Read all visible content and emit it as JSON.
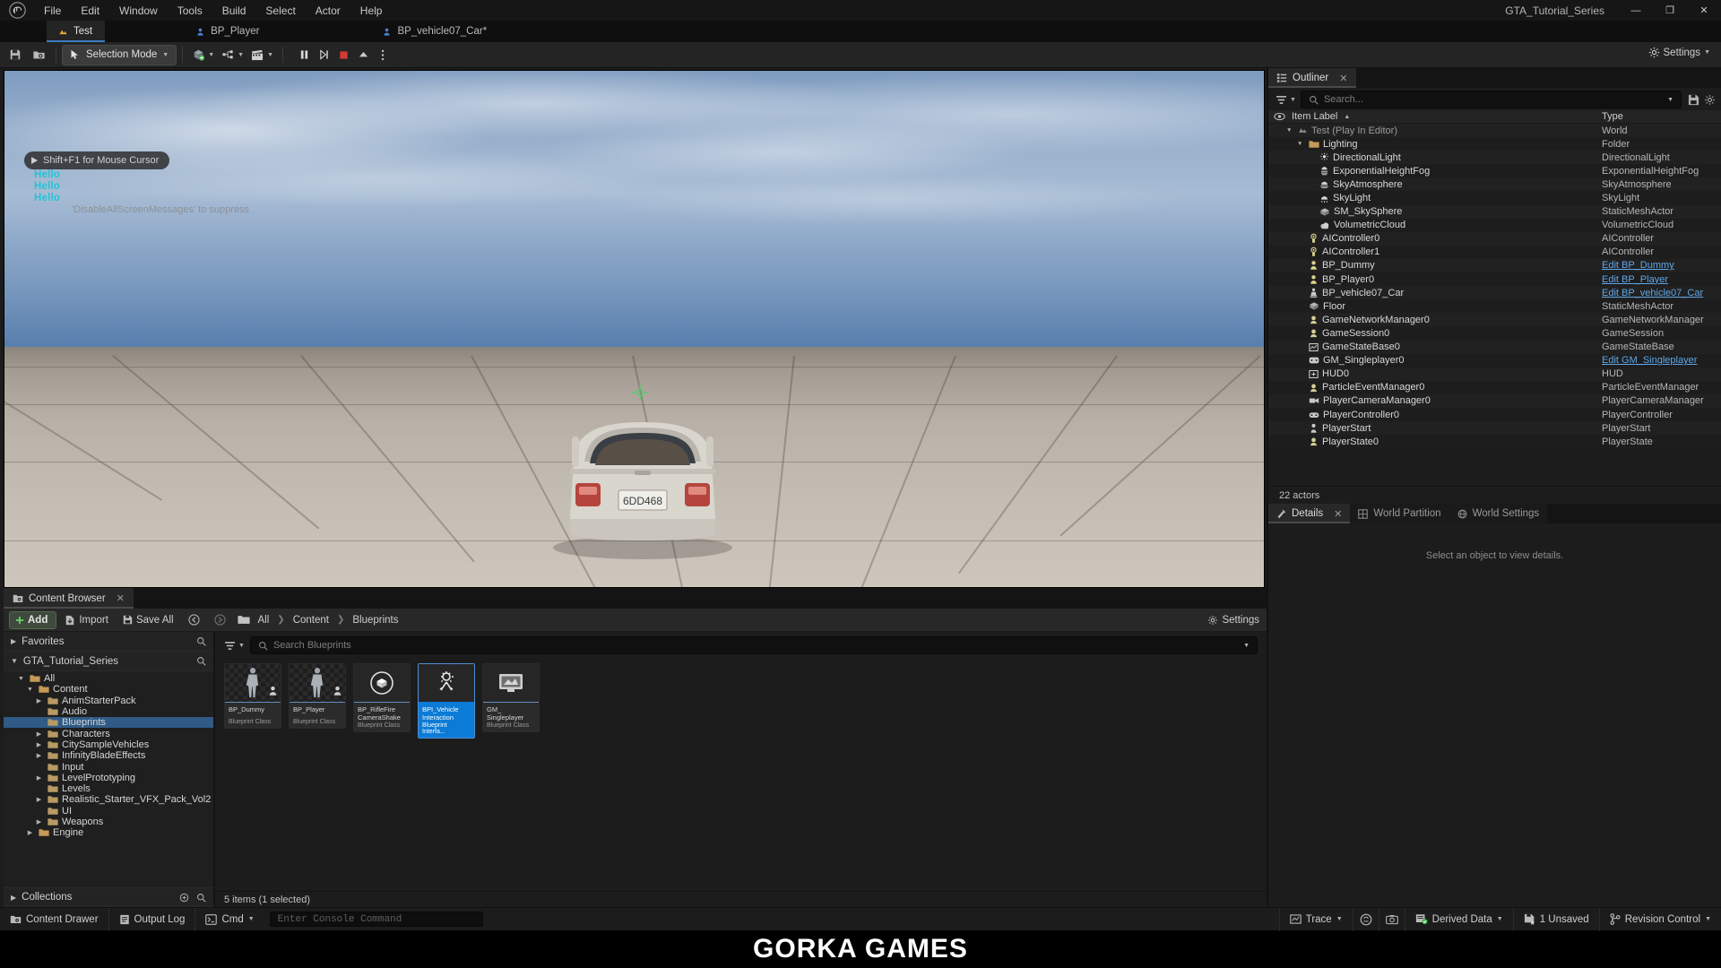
{
  "window": {
    "title": "GTA_Tutorial_Series",
    "minimize_label": "—",
    "maximize_label": "❐",
    "close_label": "✕"
  },
  "menubar": {
    "logo_name": "unreal-engine-logo",
    "items": [
      {
        "label": "File"
      },
      {
        "label": "Edit"
      },
      {
        "label": "Window"
      },
      {
        "label": "Tools"
      },
      {
        "label": "Build"
      },
      {
        "label": "Select"
      },
      {
        "label": "Actor"
      },
      {
        "label": "Help"
      }
    ]
  },
  "tabs": [
    {
      "label": "Test",
      "icon": "level-icon",
      "active": true
    },
    {
      "label": "BP_Player",
      "icon": "blueprint-icon",
      "active": false
    },
    {
      "label": "BP_vehicle07_Car*",
      "icon": "blueprint-icon",
      "active": false
    }
  ],
  "toolbar": {
    "save_icon": "save-icon",
    "browse_icon": "browse-content-icon",
    "mode_label": "Selection Mode",
    "quick_add_icon": "add-actor-icon",
    "blueprints_icon": "blueprints-icon",
    "cinematics_icon": "cinematics-icon",
    "pause_icon": "pause-icon",
    "frame_step_icon": "frame-step-icon",
    "stop_icon": "stop-icon",
    "eject_icon": "eject-icon",
    "more_icon": "more-options-icon",
    "settings_label": "Settings"
  },
  "viewport": {
    "hint": "Shift+F1 for Mouse Cursor",
    "messages": [
      "Hello",
      "Hello",
      "Hello"
    ],
    "suppress_note": "'DisableAllScreenMessages' to suppress",
    "license_plate": "6DD468",
    "colors": {
      "message": "#25c3d6",
      "sky_top": "#7e9cc0",
      "sky_bottom": "#3f6a99",
      "ground": "#c3bcb3",
      "car_body": "#d9d6ce"
    }
  },
  "outliner": {
    "tab_label": "Outliner",
    "tab_icon": "outliner-icon",
    "close_icon": "close-icon",
    "filter_icon": "filter-icon",
    "search_icon": "search-icon",
    "search_placeholder": "Search...",
    "settings_icon": "settings-icon",
    "save_icon": "save-outliner-icon",
    "columns": {
      "name": "Item Label",
      "type": "Type",
      "sort_indicator": "▲",
      "visibility_icon": "eye-icon"
    },
    "rows": [
      {
        "label": "Test (Play In Editor)",
        "type": "World",
        "indent": 1,
        "icon": "world-icon",
        "expander": "▼",
        "dim": true,
        "link": false
      },
      {
        "label": "Lighting",
        "type": "Folder",
        "indent": 2,
        "icon": "folder-icon",
        "expander": "▼",
        "dim": false,
        "link": false
      },
      {
        "label": "DirectionalLight",
        "type": "DirectionalLight",
        "indent": 3,
        "icon": "directional-light-icon",
        "expander": "",
        "dim": false,
        "link": false
      },
      {
        "label": "ExponentialHeightFog",
        "type": "ExponentialHeightFog",
        "indent": 3,
        "icon": "fog-icon",
        "expander": "",
        "dim": false,
        "link": false
      },
      {
        "label": "SkyAtmosphere",
        "type": "SkyAtmosphere",
        "indent": 3,
        "icon": "sky-atmosphere-icon",
        "expander": "",
        "dim": false,
        "link": false
      },
      {
        "label": "SkyLight",
        "type": "SkyLight",
        "indent": 3,
        "icon": "sky-light-icon",
        "expander": "",
        "dim": false,
        "link": false
      },
      {
        "label": "SM_SkySphere",
        "type": "StaticMeshActor",
        "indent": 3,
        "icon": "static-mesh-icon",
        "expander": "",
        "dim": false,
        "link": false
      },
      {
        "label": "VolumetricCloud",
        "type": "VolumetricCloud",
        "indent": 3,
        "icon": "volumetric-cloud-icon",
        "expander": "",
        "dim": false,
        "link": false
      },
      {
        "label": "AIController0",
        "type": "AIController",
        "indent": 2,
        "icon": "ai-controller-icon",
        "expander": "",
        "dim": false,
        "link": false
      },
      {
        "label": "AIController1",
        "type": "AIController",
        "indent": 2,
        "icon": "ai-controller-icon",
        "expander": "",
        "dim": false,
        "link": false
      },
      {
        "label": "BP_Dummy",
        "type": "Edit BP_Dummy",
        "indent": 2,
        "icon": "pawn-icon",
        "expander": "",
        "dim": false,
        "link": true
      },
      {
        "label": "BP_Player0",
        "type": "Edit BP_Player",
        "indent": 2,
        "icon": "pawn-icon",
        "expander": "",
        "dim": false,
        "link": true
      },
      {
        "label": "BP_vehicle07_Car",
        "type": "Edit BP_vehicle07_Car",
        "indent": 2,
        "icon": "vehicle-icon",
        "expander": "",
        "dim": false,
        "link": true
      },
      {
        "label": "Floor",
        "type": "StaticMeshActor",
        "indent": 2,
        "icon": "static-mesh-icon",
        "expander": "",
        "dim": false,
        "link": false
      },
      {
        "label": "GameNetworkManager0",
        "type": "GameNetworkManager",
        "indent": 2,
        "icon": "info-actor-icon",
        "expander": "",
        "dim": false,
        "link": false
      },
      {
        "label": "GameSession0",
        "type": "GameSession",
        "indent": 2,
        "icon": "info-actor-icon",
        "expander": "",
        "dim": false,
        "link": false
      },
      {
        "label": "GameStateBase0",
        "type": "GameStateBase",
        "indent": 2,
        "icon": "game-state-icon",
        "expander": "",
        "dim": false,
        "link": false
      },
      {
        "label": "GM_Singleplayer0",
        "type": "Edit GM_Singleplayer",
        "indent": 2,
        "icon": "game-mode-icon",
        "expander": "",
        "dim": false,
        "link": true
      },
      {
        "label": "HUD0",
        "type": "HUD",
        "indent": 2,
        "icon": "hud-icon",
        "expander": "",
        "dim": false,
        "link": false
      },
      {
        "label": "ParticleEventManager0",
        "type": "ParticleEventManager",
        "indent": 2,
        "icon": "info-actor-icon",
        "expander": "",
        "dim": false,
        "link": false
      },
      {
        "label": "PlayerCameraManager0",
        "type": "PlayerCameraManager",
        "indent": 2,
        "icon": "camera-icon",
        "expander": "",
        "dim": false,
        "link": false
      },
      {
        "label": "PlayerController0",
        "type": "PlayerController",
        "indent": 2,
        "icon": "player-controller-icon",
        "expander": "",
        "dim": false,
        "link": false
      },
      {
        "label": "PlayerStart",
        "type": "PlayerStart",
        "indent": 2,
        "icon": "player-start-icon",
        "expander": "",
        "dim": false,
        "link": false
      },
      {
        "label": "PlayerState0",
        "type": "PlayerState",
        "indent": 2,
        "icon": "info-actor-icon",
        "expander": "",
        "dim": false,
        "link": false
      }
    ],
    "footer": "22 actors"
  },
  "details": {
    "tabs": [
      {
        "label": "Details",
        "icon": "details-icon",
        "active": true,
        "closeable": true
      },
      {
        "label": "World Partition",
        "icon": "world-partition-icon",
        "active": false,
        "closeable": false
      },
      {
        "label": "World Settings",
        "icon": "world-settings-icon",
        "active": false,
        "closeable": false
      }
    ],
    "empty_message": "Select an object to view details."
  },
  "content_browser": {
    "tab_label": "Content Browser",
    "tab_icon": "content-browser-icon",
    "close_icon": "close-icon",
    "toolbar": {
      "add_label": "Add",
      "add_icon": "plus-icon",
      "import_label": "Import",
      "import_icon": "import-icon",
      "save_all_label": "Save All",
      "save_all_icon": "save-icon",
      "back_icon": "back-arrow-icon",
      "forward_icon": "forward-arrow-icon",
      "path_icon": "folder-icon",
      "settings_label": "Settings",
      "settings_icon": "gear-icon"
    },
    "breadcrumb": [
      "All",
      "Content",
      "Blueprints"
    ],
    "breadcrumb_sep": "›",
    "sources": {
      "favorites_label": "Favorites",
      "project_label": "GTA_Tutorial_Series",
      "collections_label": "Collections",
      "search_icon": "search-icon",
      "add_collection_icon": "add-collection-icon",
      "tree": [
        {
          "label": "All",
          "indent": 0,
          "expander": "▼",
          "selected": false
        },
        {
          "label": "Content",
          "indent": 1,
          "expander": "▼",
          "selected": false
        },
        {
          "label": "AnimStarterPack",
          "indent": 2,
          "expander": "▶",
          "selected": false
        },
        {
          "label": "Audio",
          "indent": 2,
          "expander": "",
          "selected": false
        },
        {
          "label": "Blueprints",
          "indent": 2,
          "expander": "",
          "selected": true
        },
        {
          "label": "Characters",
          "indent": 2,
          "expander": "▶",
          "selected": false
        },
        {
          "label": "CitySampleVehicles",
          "indent": 2,
          "expander": "▶",
          "selected": false
        },
        {
          "label": "InfinityBladeEffects",
          "indent": 2,
          "expander": "▶",
          "selected": false
        },
        {
          "label": "Input",
          "indent": 2,
          "expander": "",
          "selected": false
        },
        {
          "label": "LevelPrototyping",
          "indent": 2,
          "expander": "▶",
          "selected": false
        },
        {
          "label": "Levels",
          "indent": 2,
          "expander": "",
          "selected": false
        },
        {
          "label": "Realistic_Starter_VFX_Pack_Vol2",
          "indent": 2,
          "expander": "▶",
          "selected": false
        },
        {
          "label": "UI",
          "indent": 2,
          "expander": "",
          "selected": false
        },
        {
          "label": "Weapons",
          "indent": 2,
          "expander": "▶",
          "selected": false
        },
        {
          "label": "Engine",
          "indent": 1,
          "expander": "▶",
          "selected": false
        }
      ]
    },
    "search_placeholder": "Search Blueprints",
    "search_icon": "search-icon",
    "filter_icon": "filter-icon",
    "dropdown_icon": "chevron-down-icon",
    "assets": [
      {
        "name": "BP_Dummy",
        "type": "Blueprint Class",
        "thumb": "character-thumb",
        "selected": false
      },
      {
        "name": "BP_Player",
        "type": "Blueprint Class",
        "thumb": "character-thumb",
        "selected": false
      },
      {
        "name": "BP_RifleFire CameraShake",
        "type": "Blueprint Class",
        "thumb": "sphere-thumb",
        "selected": false
      },
      {
        "name": "BPI_Vehicle Interaction",
        "type": "Blueprint Interfa...",
        "thumb": "interface-thumb",
        "selected": true
      },
      {
        "name": "GM_ Singleplayer",
        "type": "Blueprint Class",
        "thumb": "gamemode-thumb",
        "selected": false
      }
    ],
    "status": "5 items (1 selected)"
  },
  "statusbar": {
    "left": [
      {
        "label": "Content Drawer",
        "icon": "content-drawer-icon"
      },
      {
        "label": "Output Log",
        "icon": "output-log-icon"
      },
      {
        "label": "Cmd",
        "icon": "cmd-icon",
        "caret": true
      }
    ],
    "console_placeholder": "Enter Console Command",
    "right": [
      {
        "label": "Trace",
        "icon": "trace-icon",
        "caret": true
      },
      {
        "label": "",
        "icon": "status-circle-icon",
        "caret": false
      },
      {
        "label": "",
        "icon": "screenshot-icon",
        "caret": false
      },
      {
        "label": "Derived Data",
        "icon": "derived-data-icon",
        "caret": true
      },
      {
        "label": "1 Unsaved",
        "icon": "unsaved-icon",
        "caret": false
      },
      {
        "label": "Revision Control",
        "icon": "revision-control-icon",
        "caret": true
      }
    ]
  },
  "watermark": {
    "text": "GORKA GAMES"
  }
}
